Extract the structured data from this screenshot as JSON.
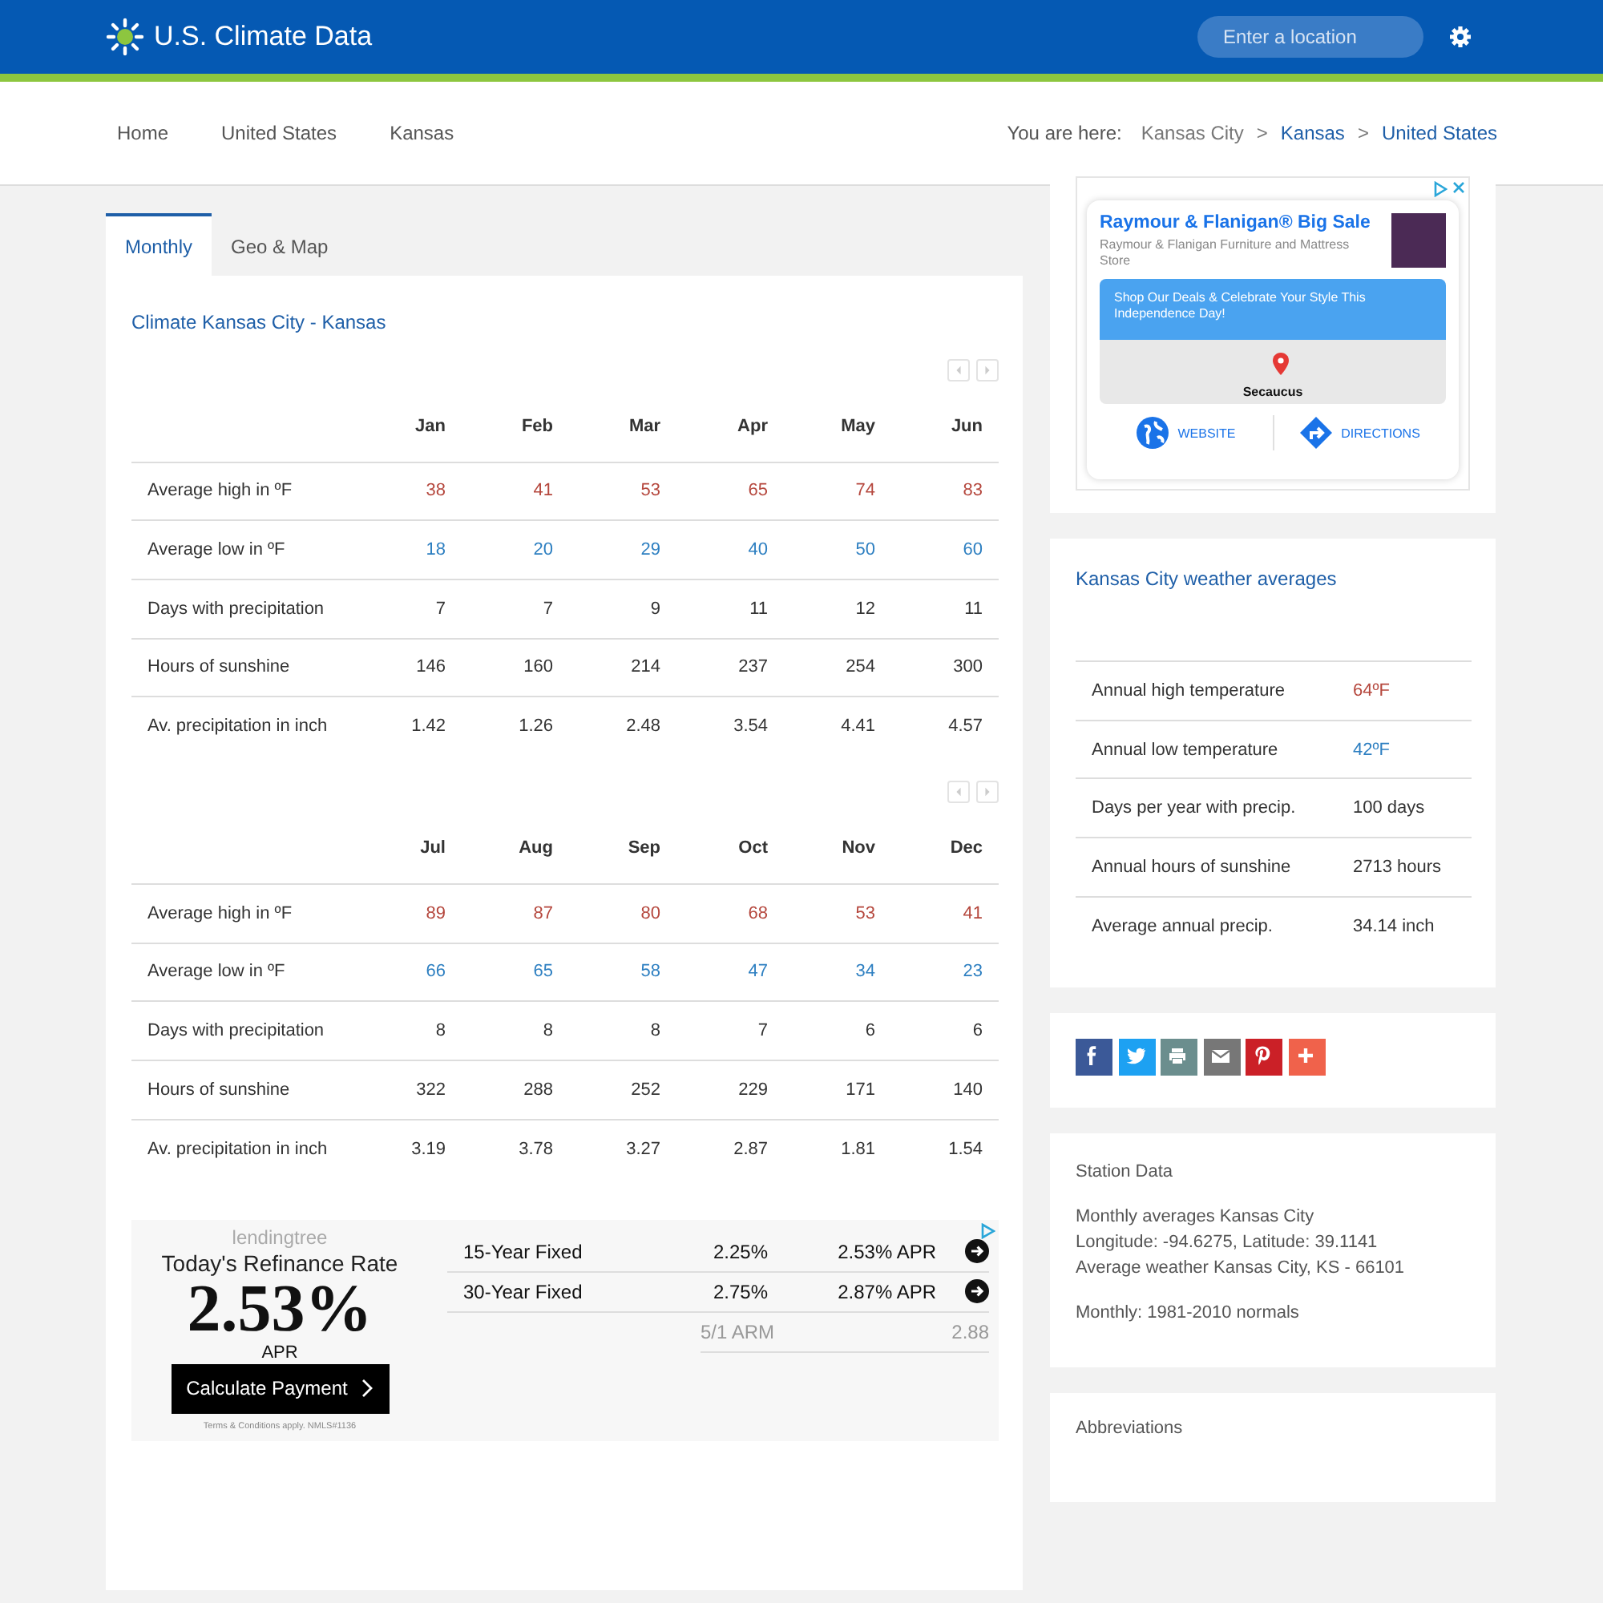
{
  "header": {
    "title": "U.S. Climate Data",
    "search": {
      "placeholder": "Enter a location"
    }
  },
  "nav": {
    "items": [
      "Home",
      "United States",
      "Kansas"
    ]
  },
  "breadcrumb": {
    "label": "You are here:",
    "items": [
      {
        "text": "Kansas City",
        "link": false
      },
      {
        "text": "Kansas",
        "link": true,
        "separator": ">"
      },
      {
        "text": "United States",
        "link": true,
        "separator": ">"
      }
    ]
  },
  "tabs": [
    {
      "label": "Monthly",
      "selected": true
    },
    {
      "label": "Geo & Map",
      "selected": false
    }
  ],
  "climate": {
    "title": "Climate Kansas City - Kansas",
    "tables": [
      {
        "months": [
          "Jan",
          "Feb",
          "Mar",
          "Apr",
          "May",
          "Jun"
        ],
        "rows": [
          {
            "label": "Average high in ºF",
            "kind": "high",
            "values": [
              "38",
              "41",
              "53",
              "65",
              "74",
              "83"
            ]
          },
          {
            "label": "Average low in ºF",
            "kind": "low",
            "values": [
              "18",
              "20",
              "29",
              "40",
              "50",
              "60"
            ]
          },
          {
            "label": "Days with precipitation",
            "kind": "plain",
            "values": [
              "7",
              "7",
              "9",
              "11",
              "12",
              "11"
            ]
          },
          {
            "label": "Hours of sunshine",
            "kind": "plain",
            "values": [
              "146",
              "160",
              "214",
              "237",
              "254",
              "300"
            ]
          },
          {
            "label": "Av. precipitation in inch",
            "kind": "plain",
            "values": [
              "1.42",
              "1.26",
              "2.48",
              "3.54",
              "4.41",
              "4.57"
            ]
          }
        ]
      },
      {
        "months": [
          "Jul",
          "Aug",
          "Sep",
          "Oct",
          "Nov",
          "Dec"
        ],
        "rows": [
          {
            "label": "Average high in ºF",
            "kind": "high",
            "values": [
              "89",
              "87",
              "80",
              "68",
              "53",
              "41"
            ]
          },
          {
            "label": "Average low in ºF",
            "kind": "low",
            "values": [
              "66",
              "65",
              "58",
              "47",
              "34",
              "23"
            ]
          },
          {
            "label": "Days with precipitation",
            "kind": "plain",
            "values": [
              "8",
              "8",
              "8",
              "7",
              "6",
              "6"
            ]
          },
          {
            "label": "Hours of sunshine",
            "kind": "plain",
            "values": [
              "322",
              "288",
              "252",
              "229",
              "171",
              "140"
            ]
          },
          {
            "label": "Av. precipitation in inch",
            "kind": "plain",
            "values": [
              "3.19",
              "3.78",
              "3.27",
              "2.87",
              "1.81",
              "1.54"
            ]
          }
        ]
      }
    ]
  },
  "refinance_ad": {
    "brand": "lendingtree",
    "heading": "Today's Refinance Rate",
    "rate": "2.53%",
    "rate_unit": "APR",
    "button": "Calculate Payment",
    "fine_print": "Terms & Conditions apply. NMLS#1136",
    "rows": [
      {
        "product": "15-Year Fixed",
        "rate": "2.25%",
        "apr": "2.53% APR",
        "kind": "full"
      },
      {
        "product": "30-Year Fixed",
        "rate": "2.75%",
        "apr": "2.87% APR",
        "kind": "full"
      },
      {
        "product": "5/1 ARM",
        "rate": "2.88",
        "kind": "faded"
      }
    ]
  },
  "store_ad": {
    "title": "Raymour & Flanigan® Big Sale",
    "subtitle": "Raymour & Flanigan Furniture and Mattress Store",
    "banner": "Shop Our Deals & Celebrate Your Style This Independence Day!",
    "map_label": "Secaucus",
    "buttons": [
      {
        "label": "WEBSITE",
        "kind": "globe"
      },
      {
        "label": "DIRECTIONS",
        "kind": "directions"
      }
    ]
  },
  "averages": {
    "title": "Kansas City weather averages",
    "rows": [
      {
        "label": "Annual high temperature",
        "value": "64ºF",
        "kind": "high"
      },
      {
        "label": "Annual low temperature",
        "value": "42ºF",
        "kind": "low"
      },
      {
        "label": "Days per year with precip.",
        "value": "100 days",
        "kind": "plain"
      },
      {
        "label": "Annual hours of sunshine",
        "value": "2713 hours",
        "kind": "plain"
      },
      {
        "label": "Average annual precip.",
        "value": "34.14 inch",
        "kind": "plain"
      }
    ]
  },
  "share": [
    {
      "kind": "facebook",
      "color": "#3b5998"
    },
    {
      "kind": "twitter",
      "color": "#1da1f2"
    },
    {
      "kind": "print",
      "color": "#6b8e8e"
    },
    {
      "kind": "email",
      "color": "#777777"
    },
    {
      "kind": "pinterest",
      "color": "#cb2027"
    },
    {
      "kind": "more",
      "color": "#f0624b"
    }
  ],
  "station": {
    "title": "Station Data",
    "lines": [
      "Monthly averages Kansas City",
      "Longitude: -94.6275, Latitude: 39.1141",
      "Average weather Kansas City, KS - 66101"
    ],
    "note": "Monthly: 1981-2010 normals"
  },
  "abbreviations": {
    "title": "Abbreviations"
  }
}
